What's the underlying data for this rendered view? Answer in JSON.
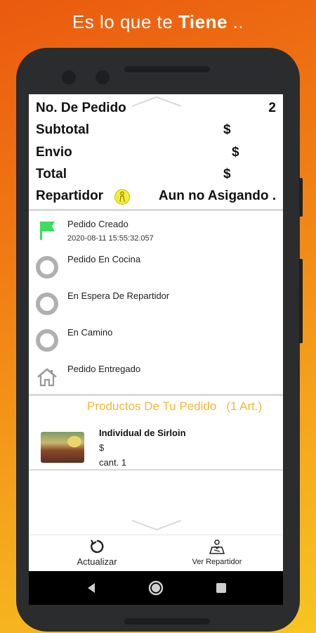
{
  "promo": {
    "prefix": "Es lo que te",
    "bold": "Tiene",
    "suffix": " .."
  },
  "summary": {
    "order_label": "No. De Pedido",
    "order_value": "2",
    "subtotal_label": "Subtotal",
    "subtotal_value": "$",
    "shipping_label": "Envio",
    "shipping_value": "$",
    "total_label": "Total",
    "total_value": "$",
    "courier_label": "Repartidor",
    "courier_value": "Aun no Asigando ."
  },
  "status_steps": [
    {
      "label": "Pedido Creado",
      "timestamp": "2020-08-11 15:55:32.057",
      "icon": "green-flag-icon"
    },
    {
      "label": "Pedido En Cocina",
      "icon": "gray-ring-icon"
    },
    {
      "label": "En Espera De Repartidor",
      "icon": "gray-ring-icon"
    },
    {
      "label": "En Camino",
      "icon": "gray-ring-icon"
    },
    {
      "label": "Pedido Entregado",
      "icon": "house-icon"
    }
  ],
  "products": {
    "heading": "Productos De Tu Pedido",
    "count": "(1 Art.)",
    "items": [
      {
        "name": "Individual de Sirloin",
        "price": "$",
        "qty": "cant. 1"
      }
    ]
  },
  "bottom_bar": {
    "refresh_label": "Actualizar",
    "courier_label": "Ver Repartidor"
  },
  "colors": {
    "accent": "#f6b733",
    "flag": "#3ddc61",
    "ring": "#b0b0b0",
    "courier_icon": "#f4ec3a"
  }
}
